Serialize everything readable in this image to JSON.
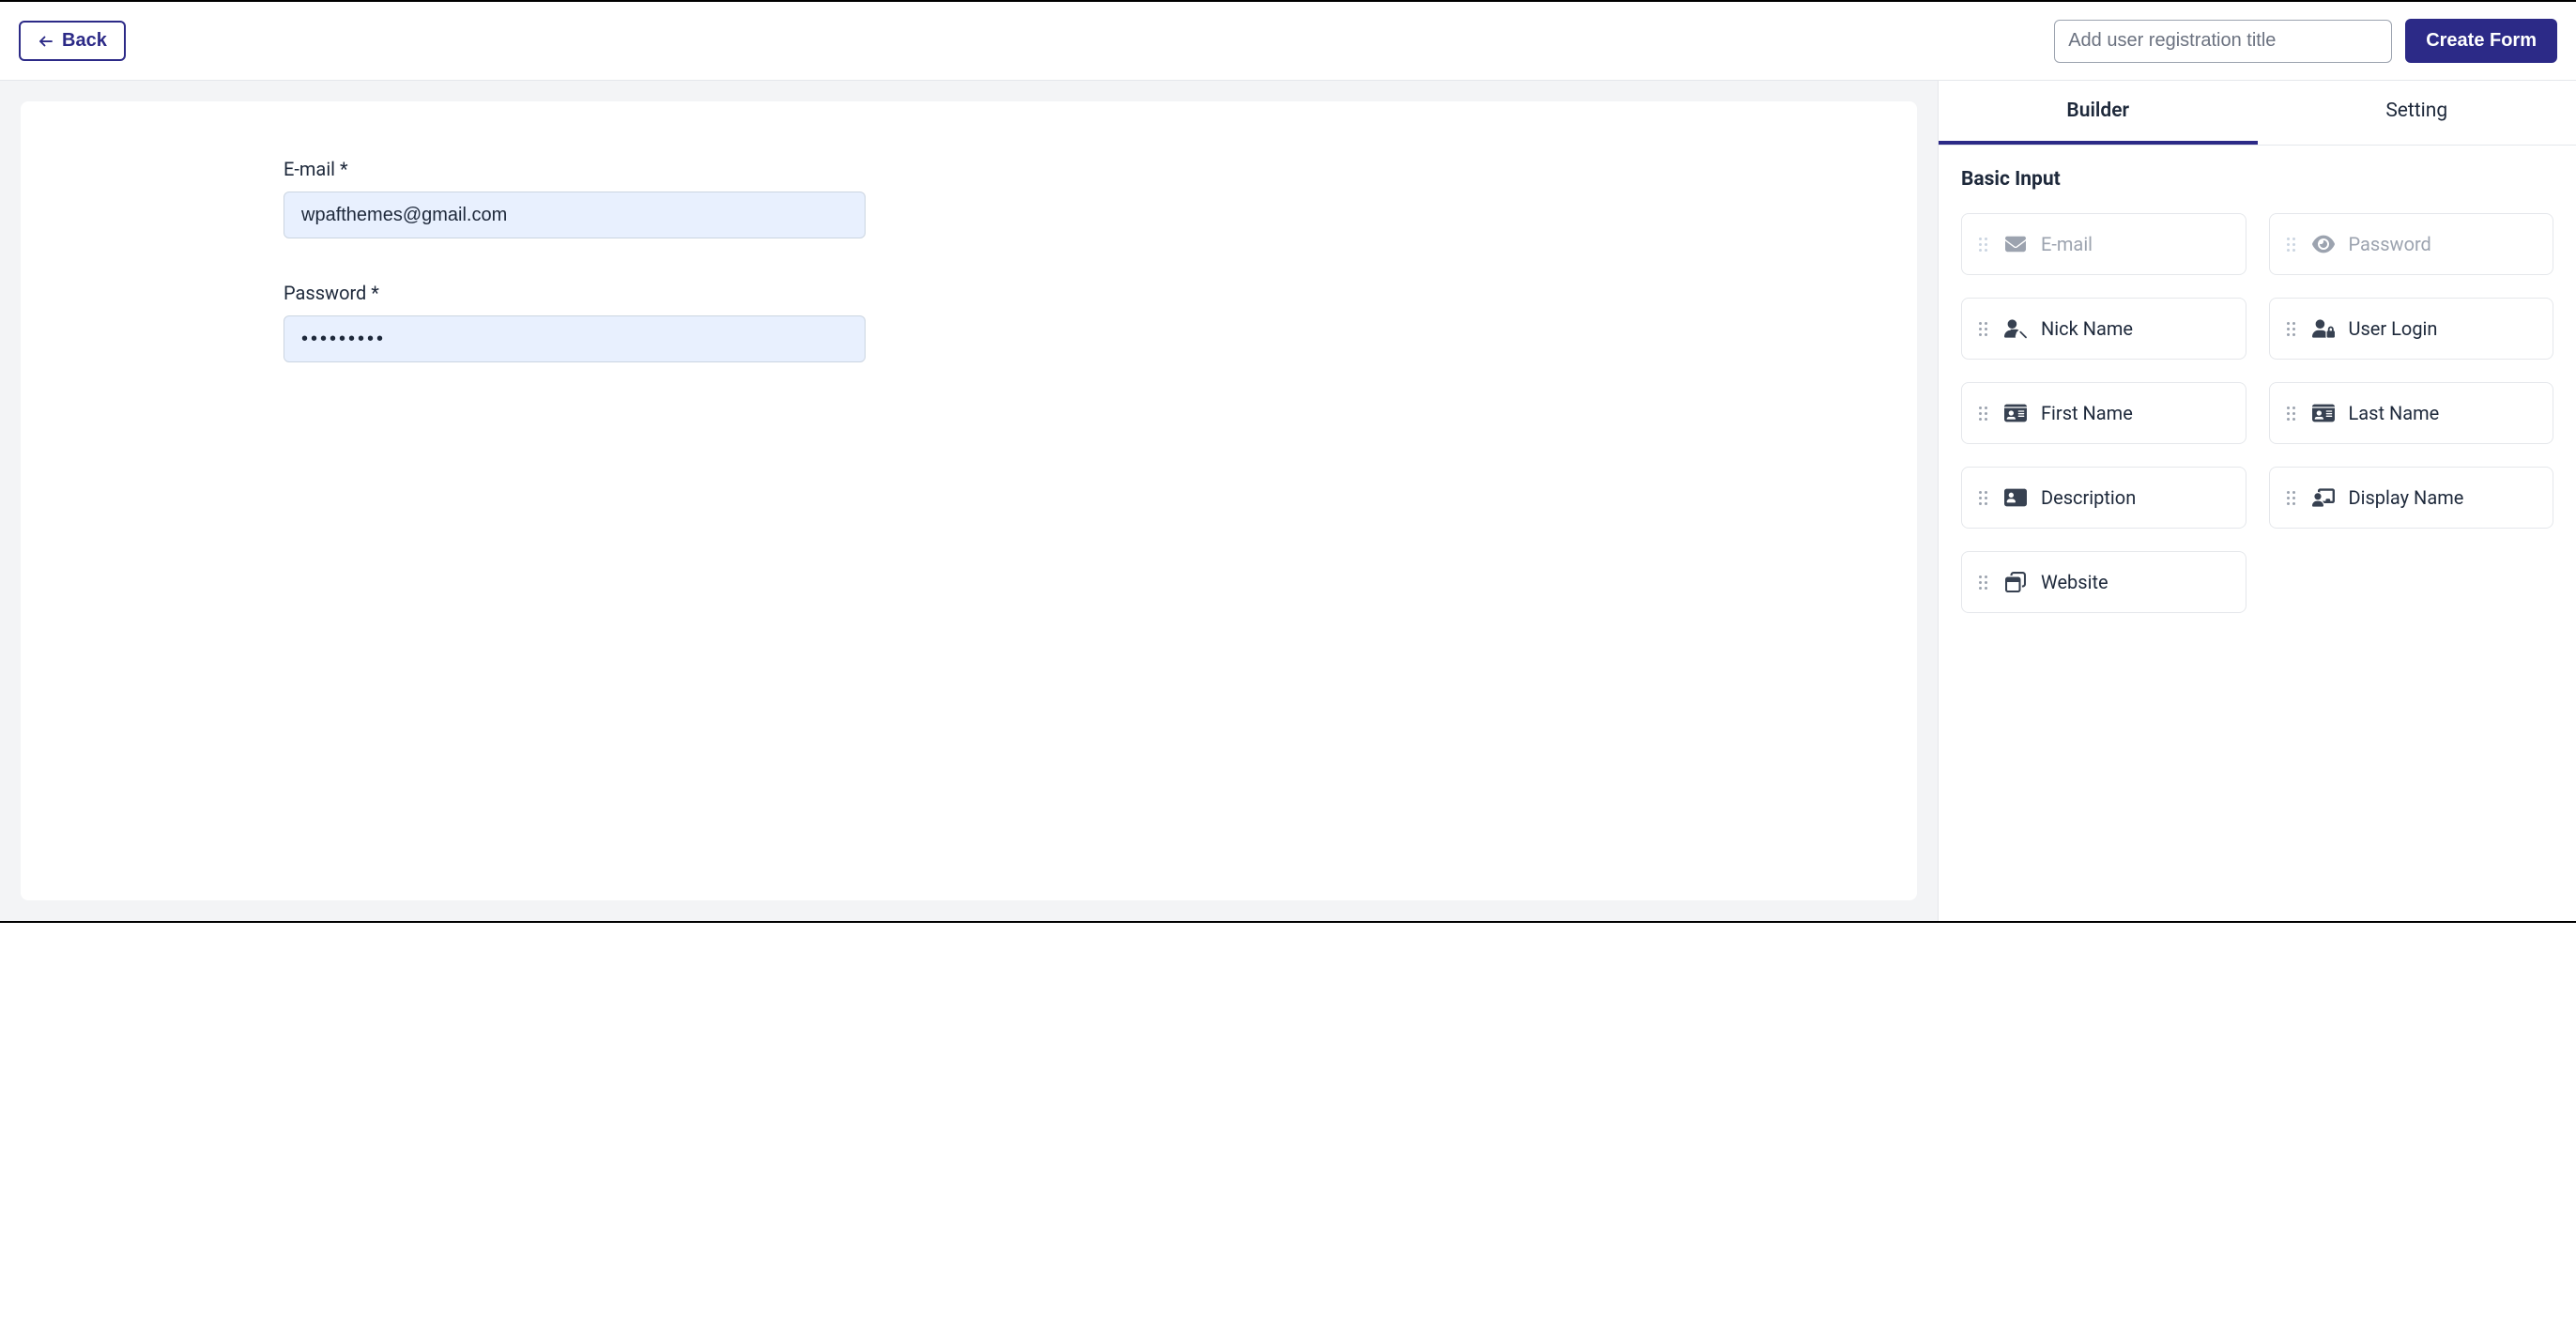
{
  "topbar": {
    "back_label": "Back",
    "title_placeholder": "Add user registration title",
    "title_value": "",
    "create_label": "Create Form"
  },
  "form": {
    "fields": [
      {
        "label": "E-mail *",
        "value": "wpafthemes@gmail.com",
        "type": "text"
      },
      {
        "label": "Password *",
        "value": "password1",
        "type": "password"
      }
    ]
  },
  "sidebar": {
    "tabs": [
      {
        "label": "Builder",
        "active": true
      },
      {
        "label": "Setting",
        "active": false
      }
    ],
    "panel_title": "Basic Input",
    "inputs": [
      {
        "label": "E-mail",
        "icon": "envelope-icon",
        "disabled": true
      },
      {
        "label": "Password",
        "icon": "eye-icon",
        "disabled": true
      },
      {
        "label": "Nick Name",
        "icon": "user-tag-icon",
        "disabled": false
      },
      {
        "label": "User Login",
        "icon": "user-lock-icon",
        "disabled": false
      },
      {
        "label": "First Name",
        "icon": "id-card-icon",
        "disabled": false
      },
      {
        "label": "Last Name",
        "icon": "id-card-icon",
        "disabled": false
      },
      {
        "label": "Description",
        "icon": "address-card-icon",
        "disabled": false
      },
      {
        "label": "Display Name",
        "icon": "chalkboard-user-icon",
        "disabled": false
      },
      {
        "label": "Website",
        "icon": "window-icon",
        "disabled": false
      }
    ]
  }
}
